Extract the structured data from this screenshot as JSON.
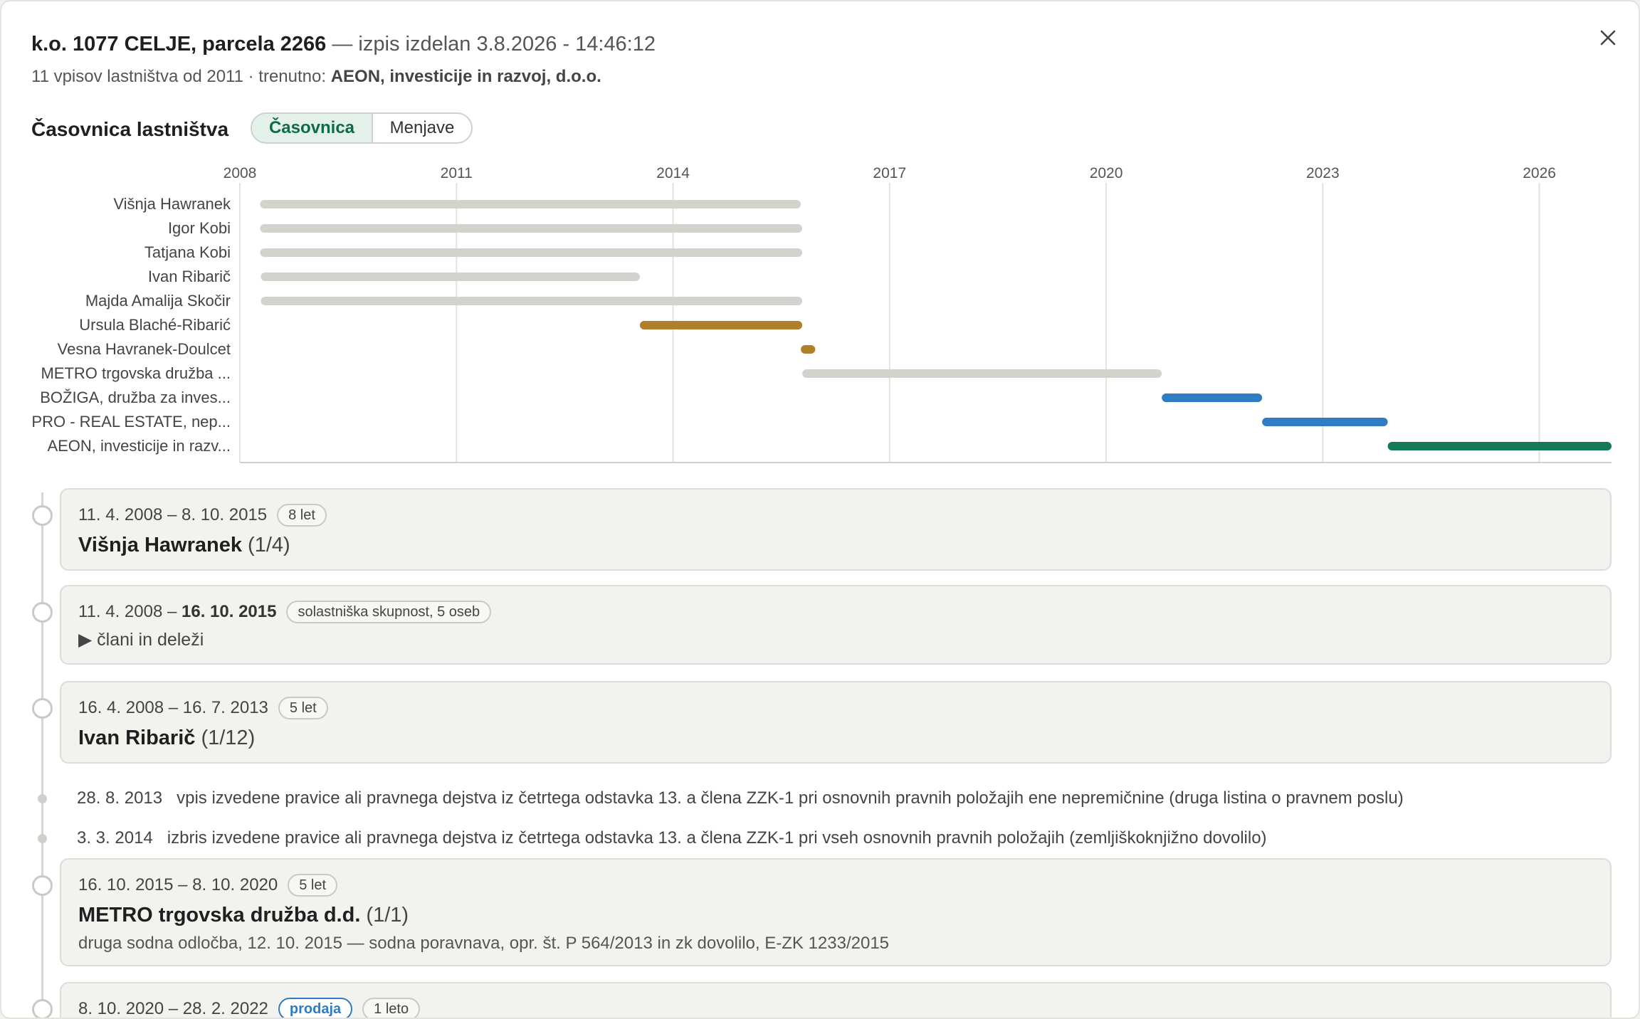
{
  "header": {
    "parcel": "k.o. 1077 CELJE, parcela 2266",
    "meta": " — izpis izdelan 3.8.2026 - 14:46:12",
    "summary_prefix": "11 vpisov lastništva od 2011 · trenutno: ",
    "current_owner": "AEON, investicije in razvoj, d.o.o."
  },
  "section": {
    "title": "Časovnica lastništva",
    "toggle_active": "Časovnica",
    "toggle_inactive": "Menjave"
  },
  "colors": {
    "gray_bar": "#d3d3ce",
    "gold_bar": "#b07f2c",
    "blue_bar": "#2f7cc4",
    "green_bar": "#127a55",
    "grid": "#e2e2df",
    "axis": "#cfcfcc"
  },
  "icons": {
    "close": "close-icon",
    "expand": "triangle-right-icon"
  },
  "chart_data": {
    "type": "bar",
    "orientation": "horizontal-range",
    "x_ticks": [
      "2008",
      "2011",
      "2014",
      "2017",
      "2020",
      "2023",
      "2026"
    ],
    "xlim": [
      2008.0,
      2027.0
    ],
    "categories": [
      "Višnja Hawranek",
      "Igor Kobi",
      "Tatjana Kobi",
      "Ivan Ribarič",
      "Majda Amalija Skočir",
      "Ursula Blaché-Ribarić",
      "Vesna Havranek-Doulcet",
      "METRO trgovska družba ...",
      "BOŽIGA, družba za inves...",
      "PRO - REAL ESTATE, nep...",
      "AEON, investicije in razv..."
    ],
    "series": [
      {
        "ranges": [
          [
            2008.28,
            2015.77
          ],
          [
            2008.28,
            2015.79
          ],
          [
            2008.28,
            2015.79
          ],
          [
            2008.29,
            2013.54
          ],
          [
            2008.29,
            2015.79
          ],
          [
            2013.54,
            2015.79
          ],
          [
            2015.77,
            2015.97
          ],
          [
            2015.79,
            2020.77
          ],
          [
            2020.77,
            2022.16
          ],
          [
            2022.16,
            2023.9
          ],
          [
            2023.9,
            2027.0
          ]
        ],
        "colors": [
          "gray",
          "gray",
          "gray",
          "gray",
          "gray",
          "gold",
          "gold",
          "gray",
          "blue",
          "blue",
          "green"
        ]
      }
    ]
  },
  "entries": [
    {
      "kind": "owner",
      "start": "11. 4. 2008",
      "end": "8. 10. 2015",
      "badge": "8 let",
      "name": "Višnja Hawranek",
      "share": " (1/4)"
    },
    {
      "kind": "group",
      "start": "11. 4. 2008",
      "end": "16. 10. 2015",
      "badge": "solastniška skupnost, 5 oseb",
      "expander": "▶ člani in deleži"
    },
    {
      "kind": "owner",
      "start": "16. 4. 2008",
      "end": "16. 7. 2013",
      "badge": "5 let",
      "name": "Ivan Ribarič",
      "share": " (1/12)"
    },
    {
      "kind": "event",
      "date": "28. 8. 2013",
      "text": "vpis izvedene pravice ali pravnega dejstva iz četrtega odstavka 13. a člena ZZK-1 pri osnovnih pravnih položajih ene nepremičnine (druga listina o pravnem poslu)"
    },
    {
      "kind": "event",
      "date": "3. 3. 2014",
      "text": "izbris izvedene pravice ali pravnega dejstva iz četrtega odstavka 13. a člena ZZK-1 pri vseh osnovnih pravnih položajih (zemljiškoknjižno dovolilo)"
    },
    {
      "kind": "owner",
      "start": "16. 10. 2015",
      "end": "8. 10. 2020",
      "badge": "5 let",
      "name": "METRO trgovska družba d.d.",
      "share": " (1/1)",
      "note": "druga sodna odločba, 12. 10. 2015 — sodna poravnava, opr. št. P 564/2013 in zk dovolilo, E-ZK 1233/2015"
    },
    {
      "kind": "owner",
      "start": "8. 10. 2020",
      "end": "28. 2. 2022",
      "tag": "prodaja",
      "badge": "1 leto"
    }
  ]
}
